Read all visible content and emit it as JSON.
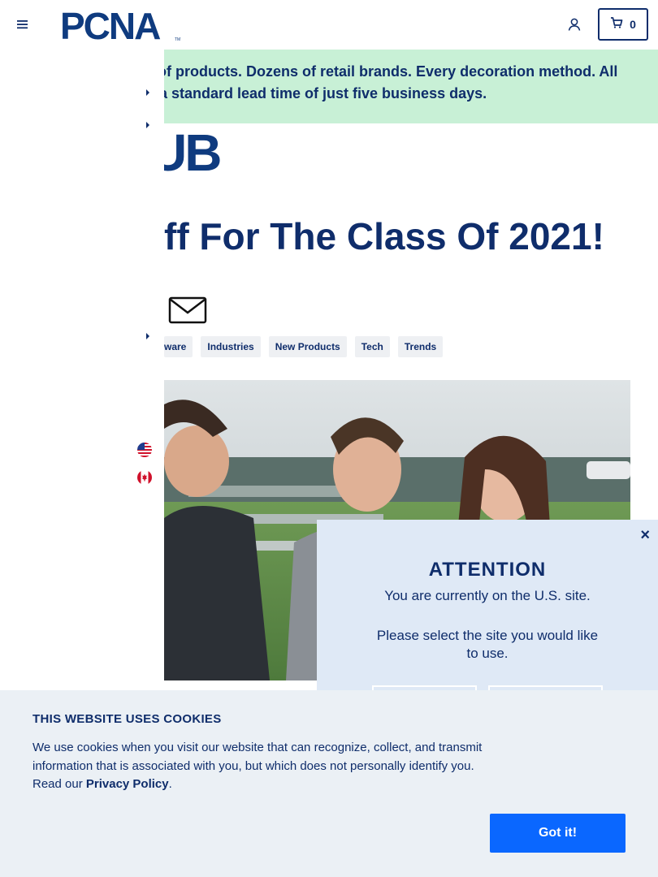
{
  "header": {
    "logo_text": "PCNA",
    "cart_count": "0"
  },
  "promo": {
    "line1": "ls of products. Dozens of retail brands. Every decoration method. All",
    "line2": "th a standard lead time of just five business days."
  },
  "hub_logo_text": "UB",
  "article": {
    "title": "ff For The Class Of 2021!"
  },
  "tags": [
    "ware",
    "Industries",
    "New Products",
    "Tech",
    "Trends"
  ],
  "modal": {
    "close": "×",
    "heading": "ATTENTION",
    "text1": "You are currently on the U.S. site.",
    "text2": "Please select the site you would like to use."
  },
  "cookie": {
    "title": "THIS WEBSITE USES COOKIES",
    "text": "We use cookies when you visit our website that can recognize, collect, and transmit information that is associated with you, but which does not personally identify you. Read our ",
    "link": "Privacy Policy",
    "suffix": ".",
    "button": "Got it!"
  },
  "colors": {
    "brand_navy": "#0f2d6b",
    "promo_bg": "#c8f0d6",
    "cookie_bg": "#ebf0f5",
    "modal_bg": "#dfe9f6",
    "accept_button": "#0a67ff"
  },
  "icons": [
    "hamburger-menu-icon",
    "account-icon",
    "cart-icon",
    "caret-right-icon",
    "mail-icon",
    "us-flag-icon",
    "canada-flag-icon",
    "close-icon"
  ]
}
